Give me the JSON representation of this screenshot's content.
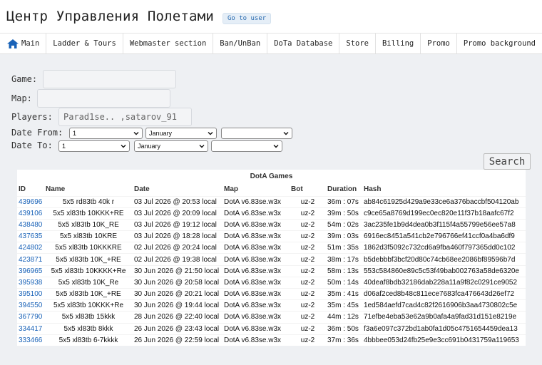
{
  "header": {
    "title": "Центр Управления Полетами",
    "goto_user": "Go to user"
  },
  "nav": {
    "items": [
      "Main",
      "Ladder & Tours",
      "Webmaster section",
      "Ban/UnBan",
      "DoTa Database",
      "Store",
      "Billing",
      "Promo",
      "Promo background"
    ]
  },
  "form": {
    "game_label": "Game:",
    "game_value": "",
    "map_label": "Map:",
    "map_value": "",
    "players_label": "Players:",
    "players_value": "Parad1se.. ,satarov_91",
    "date_from_label": "Date From:",
    "date_from_day": "1",
    "date_from_month": "January",
    "date_from_year": "",
    "date_to_label": "Date To:",
    "date_to_day": "1",
    "date_to_month": "January",
    "date_to_year": "",
    "search_button": "Search"
  },
  "games": {
    "title": "DotA Games",
    "columns": [
      "ID",
      "Name",
      "Date",
      "Map",
      "Bot",
      "Duration",
      "Hash"
    ],
    "rows": [
      [
        "439696",
        "5x5 rd83tb 40k r",
        "03 Jul 2026 @ 20:53 local",
        "DotA v6.83se.w3x",
        "uz-2",
        "36m : 07s",
        "ab84c61925d429a9e33ce6a376baccbf504120ab"
      ],
      [
        "439106",
        "5x5 xl83tb 10KKK+RE",
        "03 Jul 2026 @ 20:09 local",
        "DotA v6.83se.w3x",
        "uz-2",
        "39m : 50s",
        "c9ce65a8769d199ec0ec820e11f37b18aafc67f2"
      ],
      [
        "438480",
        "5x5 xl83tb 10K_RE",
        "03 Jul 2026 @ 19:12 local",
        "DotA v6.83se.w3x",
        "uz-2",
        "54m : 02s",
        "3ac235fe1b9d4dea0b3f115f4a55799e56ee57a8"
      ],
      [
        "437635",
        "5x5 xl83tb 10KRE",
        "03 Jul 2026 @ 18:28 local",
        "DotA v6.83se.w3x",
        "uz-2",
        "39m : 03s",
        "6916ec8451a541cb2e796766ef41ccf0a4ba6df9"
      ],
      [
        "424802",
        "5x5 xl83tb 10KKKRE",
        "02 Jul 2026 @ 20:24 local",
        "DotA v6.83se.w3x",
        "uz-2",
        "51m : 35s",
        "1862d3f5092c732cd6a9fba460f797365dd0c102"
      ],
      [
        "423871",
        "5x5 xl83tb 10K_+RE",
        "02 Jul 2026 @ 19:38 local",
        "DotA v6.83se.w3x",
        "uz-2",
        "38m : 17s",
        "b5debbbf3bcf20d80c74cb68ee2086bf89596b7d"
      ],
      [
        "396965",
        "5x5 xl83tb 10KKKK+Re",
        "30 Jun 2026 @ 21:50 local",
        "DotA v6.83se.w3x",
        "uz-2",
        "58m : 13s",
        "553c584860e89c5c53f49bab002763a58de6320e"
      ],
      [
        "395938",
        "5x5 xl83tb 10K_Re",
        "30 Jun 2026 @ 20:58 local",
        "DotA v6.83se.w3x",
        "uz-2",
        "50m : 14s",
        "40deaf8bdb32186dab228a11a9f82c0291ce9052"
      ],
      [
        "395100",
        "5x5 xl83tb 10K_+RE",
        "30 Jun 2026 @ 20:21 local",
        "DotA v6.83se.w3x",
        "uz-2",
        "35m : 41s",
        "d06af2ced8b48c811ece7683fca476643d26ef72"
      ],
      [
        "394550",
        "5x5 xl83tb 10KKK+Re",
        "30 Jun 2026 @ 19:44 local",
        "DotA v6.83se.w3x",
        "uz-2",
        "35m : 45s",
        "1ed584aefd7cad4c82f2616906b3aa4730802c5e"
      ],
      [
        "367790",
        "5x5 xl83tb 15kkk",
        "28 Jun 2026 @ 22:40 local",
        "DotA v6.83se.w3x",
        "uz-2",
        "44m : 12s",
        "71efbe4eba53e62a9b0afa4a9fad31d151e8219e"
      ],
      [
        "334417",
        "5x5 xl83tb 8kkk",
        "26 Jun 2026 @ 23:43 local",
        "DotA v6.83se.w3x",
        "uz-2",
        "36m : 50s",
        "f3a6e097c372bd1ab0fa1d05c4751654459dea13"
      ],
      [
        "333466",
        "5x5 xl83tb 6-7kkkk",
        "26 Jun 2026 @ 22:59 local",
        "DotA v6.83se.w3x",
        "uz-2",
        "37m : 36s",
        "4bbbee053d24fb25e9e3cc691b0431759a119653"
      ]
    ]
  }
}
